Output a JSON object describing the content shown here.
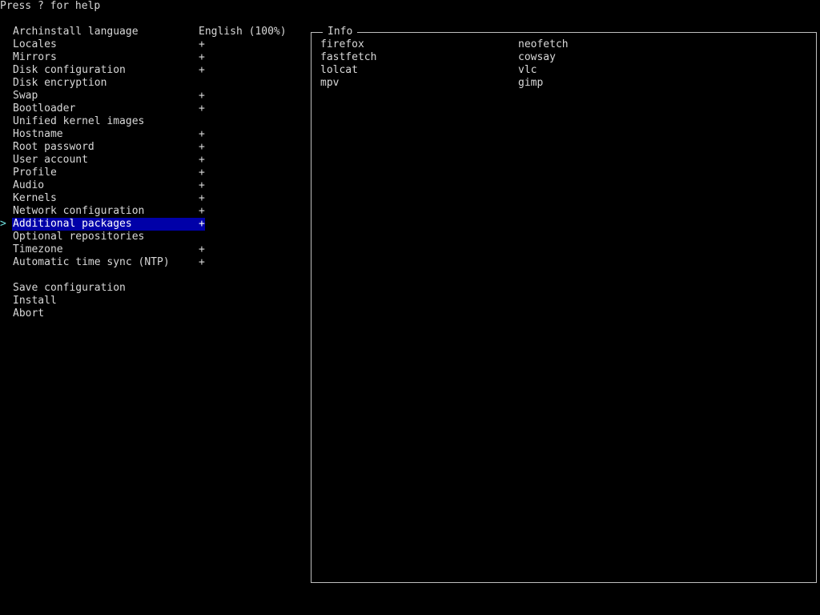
{
  "help_text": "Press ? for help",
  "menu": {
    "items": [
      {
        "label": "Archinstall language",
        "value": "English (100%)",
        "selected": false
      },
      {
        "label": "Locales",
        "value": "+",
        "selected": false
      },
      {
        "label": "Mirrors",
        "value": "+",
        "selected": false
      },
      {
        "label": "Disk configuration",
        "value": "+",
        "selected": false
      },
      {
        "label": "Disk encryption",
        "value": "",
        "selected": false
      },
      {
        "label": "Swap",
        "value": "+",
        "selected": false
      },
      {
        "label": "Bootloader",
        "value": "+",
        "selected": false
      },
      {
        "label": "Unified kernel images",
        "value": "",
        "selected": false
      },
      {
        "label": "Hostname",
        "value": "+",
        "selected": false
      },
      {
        "label": "Root password",
        "value": "+",
        "selected": false
      },
      {
        "label": "User account",
        "value": "+",
        "selected": false
      },
      {
        "label": "Profile",
        "value": "+",
        "selected": false
      },
      {
        "label": "Audio",
        "value": "+",
        "selected": false
      },
      {
        "label": "Kernels",
        "value": "+",
        "selected": false
      },
      {
        "label": "Network configuration",
        "value": "+",
        "selected": false
      },
      {
        "label": "Additional packages",
        "value": "+",
        "selected": true
      },
      {
        "label": "Optional repositories",
        "value": "",
        "selected": false
      },
      {
        "label": "Timezone",
        "value": "+",
        "selected": false
      },
      {
        "label": "Automatic time sync (NTP)",
        "value": "+",
        "selected": false
      }
    ],
    "actions": [
      {
        "label": "Save configuration"
      },
      {
        "label": "Install"
      },
      {
        "label": "Abort"
      }
    ],
    "cursor_glyph": ">"
  },
  "info": {
    "title": "Info",
    "packages": [
      "firefox",
      "neofetch",
      "fastfetch",
      "cowsay",
      "lolcat",
      "vlc",
      "mpv",
      "gimp"
    ]
  },
  "colors": {
    "background": "#000000",
    "text": "#d8d8d8",
    "selection": "#0000a8",
    "cursor": "#6fe0e0",
    "border": "#bfbfbf"
  }
}
